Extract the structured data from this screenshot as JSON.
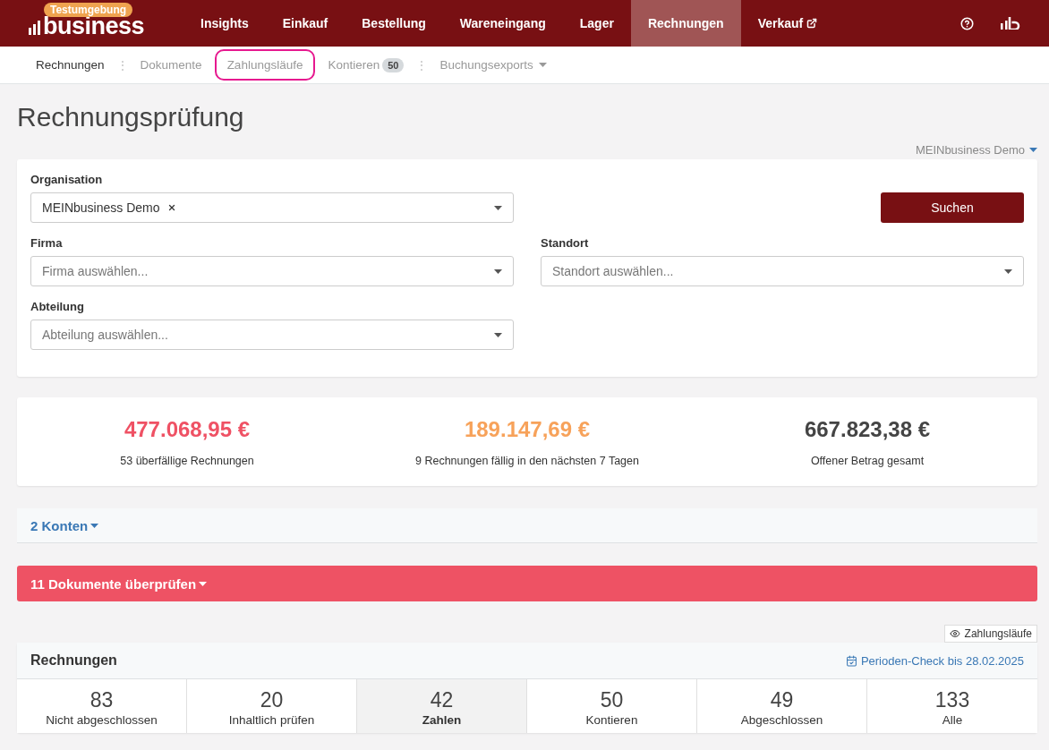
{
  "nav": {
    "badge": "Testumgebung",
    "logo": "business",
    "items": [
      {
        "label": "Insights",
        "selected": false,
        "external": false
      },
      {
        "label": "Einkauf",
        "selected": false,
        "external": false
      },
      {
        "label": "Bestellung",
        "selected": false,
        "external": false
      },
      {
        "label": "Wareneingang",
        "selected": false,
        "external": false
      },
      {
        "label": "Lager",
        "selected": false,
        "external": false
      },
      {
        "label": "Rechnungen",
        "selected": true,
        "external": false
      },
      {
        "label": "Verkauf",
        "selected": false,
        "external": true
      }
    ]
  },
  "subnav": [
    {
      "label": "Rechnungen",
      "selected": true,
      "highlighted": false,
      "divider": "⋮"
    },
    {
      "label": "Dokumente",
      "selected": false,
      "highlighted": false
    },
    {
      "label": "Zahlungsläufe",
      "selected": false,
      "highlighted": true
    },
    {
      "label": "Kontieren",
      "selected": false,
      "highlighted": false,
      "divider": "⋮",
      "count": "50"
    },
    {
      "label": "Buchungsexports",
      "selected": false,
      "highlighted": false,
      "dropdown": true
    }
  ],
  "title": "Rechnungsprüfung",
  "org_switch": {
    "label": "MEINbusiness Demo",
    "expanded": false
  },
  "filters": {
    "organisation": {
      "label": "Organisation",
      "value": "MEINbusiness Demo"
    },
    "search_button": "Suchen",
    "firma": {
      "label": "Firma",
      "placeholder": "Firma auswählen..."
    },
    "standort": {
      "label": "Standort",
      "placeholder": "Standort auswählen..."
    },
    "abteilung": {
      "label": "Abteilung",
      "placeholder": "Abteilung auswählen..."
    }
  },
  "stats": [
    {
      "amount": "477.068,95 €",
      "caption": "53 überfällige Rechnungen",
      "color": "#ef5164"
    },
    {
      "amount": "189.147,69 €",
      "caption": "9 Rechnungen fällig in den nächsten 7 Tagen",
      "color": "#f7a25a"
    },
    {
      "amount": "667.823,38 €",
      "caption": "Offener Betrag gesamt",
      "color": "#444444"
    }
  ],
  "accounts_bar": "2 Konten",
  "review_bar": "11 Dokumente überprüfen",
  "payment_runs_button": "Zahlungsläufe",
  "invoices": {
    "title": "Rechnungen",
    "period_check": "Perioden-Check bis 28.02.2025",
    "tabs": [
      {
        "count": "83",
        "label": "Nicht abgeschlossen",
        "selected": false
      },
      {
        "count": "20",
        "label": "Inhaltlich prüfen",
        "selected": false
      },
      {
        "count": "42",
        "label": "Zahlen",
        "selected": true
      },
      {
        "count": "50",
        "label": "Kontieren",
        "selected": false
      },
      {
        "count": "49",
        "label": "Abgeschlossen",
        "selected": false
      },
      {
        "count": "133",
        "label": "Alle",
        "selected": false
      }
    ]
  }
}
